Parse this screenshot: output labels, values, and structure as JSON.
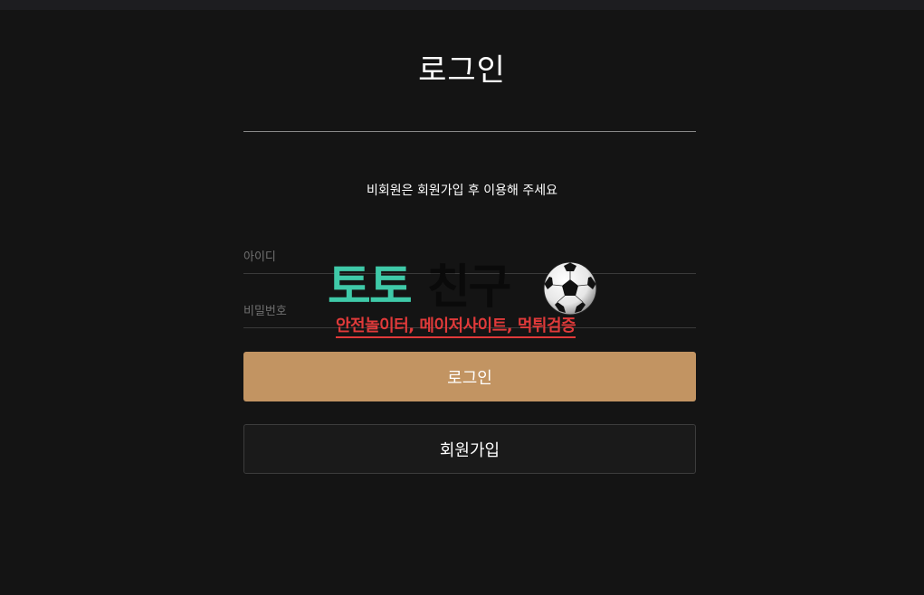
{
  "page": {
    "title": "로그인",
    "notice": "비회원은 회원가입 후 이용해 주세요"
  },
  "form": {
    "id_placeholder": "아이디",
    "password_placeholder": "비밀번호",
    "login_label": "로그인",
    "signup_label": "회원가입"
  },
  "watermark": {
    "brand_part1": "토토",
    "brand_part2": "친구",
    "tagline": "안전놀이터, 메이저사이트, 먹튀검증",
    "icon": "soccer-ball-icon"
  },
  "colors": {
    "background": "#141414",
    "login_button": "#c29462",
    "brand_teal": "#3fc9a8",
    "tagline_red": "#e03a3a"
  }
}
